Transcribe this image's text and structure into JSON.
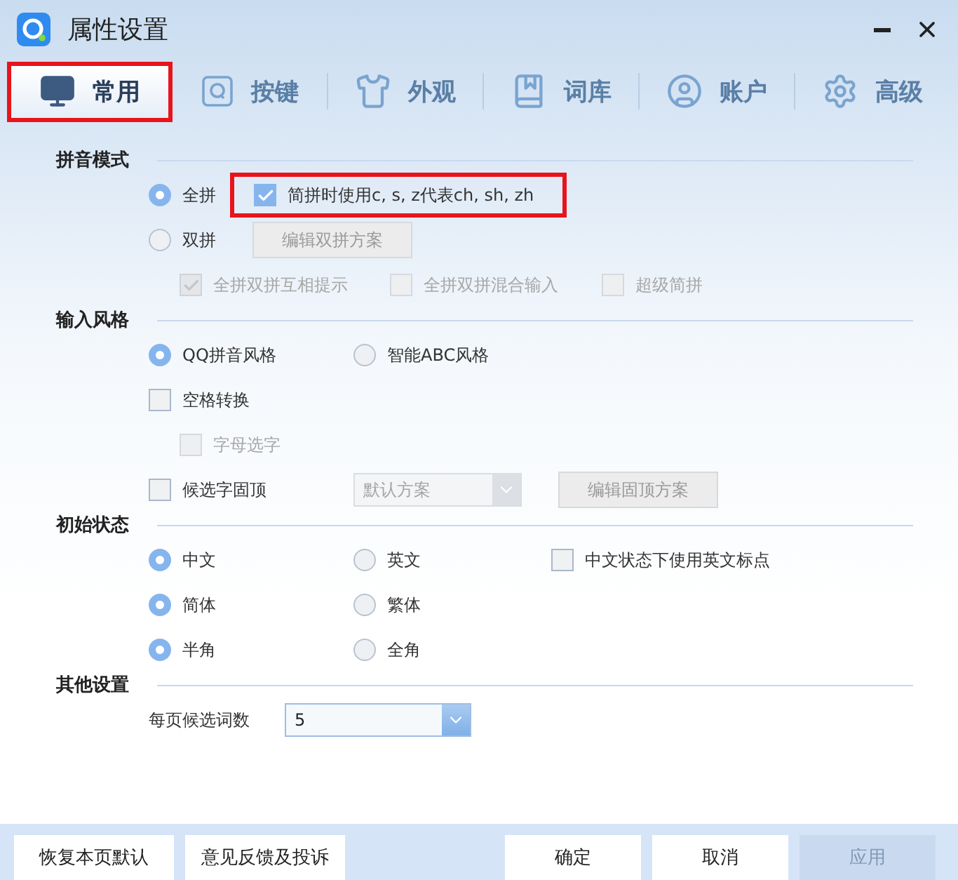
{
  "window": {
    "title": "属性设置"
  },
  "tabs": [
    {
      "label": "常用",
      "selected": true,
      "highlighted": true
    },
    {
      "label": "按键",
      "selected": false,
      "highlighted": false
    },
    {
      "label": "外观",
      "selected": false,
      "highlighted": false
    },
    {
      "label": "词库",
      "selected": false,
      "highlighted": false
    },
    {
      "label": "账户",
      "selected": false,
      "highlighted": false
    },
    {
      "label": "高级",
      "selected": false,
      "highlighted": false
    }
  ],
  "sections": [
    {
      "title": "拼音模式",
      "rows": [
        {
          "items": [
            {
              "kind": "radio",
              "label": "全拼",
              "selected": true
            },
            {
              "kind": "checkbox",
              "label": "简拼时使用c, s, z代表ch, sh, zh",
              "checked": true,
              "disabled": false,
              "highlighted": true
            }
          ]
        },
        {
          "items": [
            {
              "kind": "radio",
              "label": "双拼",
              "selected": false
            },
            {
              "kind": "button",
              "label": "编辑双拼方案",
              "disabled": true
            }
          ],
          "children": [
            {
              "items": [
                {
                  "kind": "checkbox",
                  "label": "全拼双拼互相提示",
                  "checked": true,
                  "disabled": true
                },
                {
                  "kind": "checkbox",
                  "label": "全拼双拼混合输入",
                  "checked": false,
                  "disabled": true
                },
                {
                  "kind": "checkbox",
                  "label": "超级简拼",
                  "checked": false,
                  "disabled": true
                }
              ]
            }
          ]
        }
      ]
    },
    {
      "title": "输入风格",
      "rows": [
        {
          "items": [
            {
              "kind": "radio",
              "label": "QQ拼音风格",
              "selected": true
            },
            {
              "kind": "radio",
              "label": "智能ABC风格",
              "selected": false
            }
          ]
        },
        {
          "items": [
            {
              "kind": "checkbox",
              "label": "空格转换",
              "checked": false,
              "disabled": false
            }
          ],
          "children": [
            {
              "items": [
                {
                  "kind": "checkbox",
                  "label": "字母选字",
                  "checked": false,
                  "disabled": true
                }
              ]
            }
          ]
        },
        {
          "items": [
            {
              "kind": "checkbox",
              "label": "候选字固顶",
              "checked": false,
              "disabled": false
            },
            {
              "kind": "select",
              "value": "默认方案",
              "disabled": true
            },
            {
              "kind": "button",
              "label": "编辑固顶方案",
              "disabled": true
            }
          ]
        }
      ]
    },
    {
      "title": "初始状态",
      "rows": [
        {
          "items": [
            {
              "kind": "radio",
              "label": "中文",
              "selected": true
            },
            {
              "kind": "radio",
              "label": "英文",
              "selected": false
            },
            {
              "kind": "checkbox",
              "label": "中文状态下使用英文标点",
              "checked": false,
              "disabled": false
            }
          ]
        },
        {
          "items": [
            {
              "kind": "radio",
              "label": "简体",
              "selected": true
            },
            {
              "kind": "radio",
              "label": "繁体",
              "selected": false
            }
          ]
        },
        {
          "items": [
            {
              "kind": "radio",
              "label": "半角",
              "selected": true
            },
            {
              "kind": "radio",
              "label": "全角",
              "selected": false
            }
          ]
        }
      ]
    },
    {
      "title": "其他设置",
      "rows": [
        {
          "items": [
            {
              "kind": "label",
              "label": "每页候选词数"
            },
            {
              "kind": "select",
              "value": "5",
              "disabled": false
            }
          ]
        }
      ]
    }
  ],
  "footer": {
    "left": [
      {
        "label": "恢复本页默认",
        "disabled": false
      },
      {
        "label": "意见反馈及投诉",
        "disabled": false
      }
    ],
    "right": [
      {
        "label": "确定",
        "disabled": false
      },
      {
        "label": "取消",
        "disabled": false
      },
      {
        "label": "应用",
        "disabled": true
      }
    ]
  }
}
